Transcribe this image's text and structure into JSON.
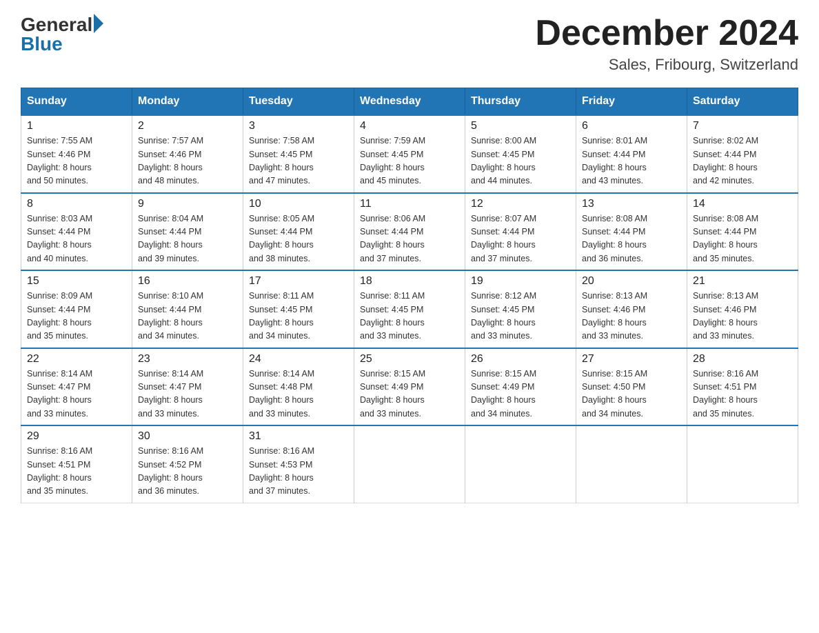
{
  "logo": {
    "general": "General",
    "blue": "Blue"
  },
  "title": "December 2024",
  "subtitle": "Sales, Fribourg, Switzerland",
  "days_of_week": [
    "Sunday",
    "Monday",
    "Tuesday",
    "Wednesday",
    "Thursday",
    "Friday",
    "Saturday"
  ],
  "weeks": [
    [
      {
        "day": 1,
        "info": "Sunrise: 7:55 AM\nSunset: 4:46 PM\nDaylight: 8 hours\nand 50 minutes."
      },
      {
        "day": 2,
        "info": "Sunrise: 7:57 AM\nSunset: 4:46 PM\nDaylight: 8 hours\nand 48 minutes."
      },
      {
        "day": 3,
        "info": "Sunrise: 7:58 AM\nSunset: 4:45 PM\nDaylight: 8 hours\nand 47 minutes."
      },
      {
        "day": 4,
        "info": "Sunrise: 7:59 AM\nSunset: 4:45 PM\nDaylight: 8 hours\nand 45 minutes."
      },
      {
        "day": 5,
        "info": "Sunrise: 8:00 AM\nSunset: 4:45 PM\nDaylight: 8 hours\nand 44 minutes."
      },
      {
        "day": 6,
        "info": "Sunrise: 8:01 AM\nSunset: 4:44 PM\nDaylight: 8 hours\nand 43 minutes."
      },
      {
        "day": 7,
        "info": "Sunrise: 8:02 AM\nSunset: 4:44 PM\nDaylight: 8 hours\nand 42 minutes."
      }
    ],
    [
      {
        "day": 8,
        "info": "Sunrise: 8:03 AM\nSunset: 4:44 PM\nDaylight: 8 hours\nand 40 minutes."
      },
      {
        "day": 9,
        "info": "Sunrise: 8:04 AM\nSunset: 4:44 PM\nDaylight: 8 hours\nand 39 minutes."
      },
      {
        "day": 10,
        "info": "Sunrise: 8:05 AM\nSunset: 4:44 PM\nDaylight: 8 hours\nand 38 minutes."
      },
      {
        "day": 11,
        "info": "Sunrise: 8:06 AM\nSunset: 4:44 PM\nDaylight: 8 hours\nand 37 minutes."
      },
      {
        "day": 12,
        "info": "Sunrise: 8:07 AM\nSunset: 4:44 PM\nDaylight: 8 hours\nand 37 minutes."
      },
      {
        "day": 13,
        "info": "Sunrise: 8:08 AM\nSunset: 4:44 PM\nDaylight: 8 hours\nand 36 minutes."
      },
      {
        "day": 14,
        "info": "Sunrise: 8:08 AM\nSunset: 4:44 PM\nDaylight: 8 hours\nand 35 minutes."
      }
    ],
    [
      {
        "day": 15,
        "info": "Sunrise: 8:09 AM\nSunset: 4:44 PM\nDaylight: 8 hours\nand 35 minutes."
      },
      {
        "day": 16,
        "info": "Sunrise: 8:10 AM\nSunset: 4:44 PM\nDaylight: 8 hours\nand 34 minutes."
      },
      {
        "day": 17,
        "info": "Sunrise: 8:11 AM\nSunset: 4:45 PM\nDaylight: 8 hours\nand 34 minutes."
      },
      {
        "day": 18,
        "info": "Sunrise: 8:11 AM\nSunset: 4:45 PM\nDaylight: 8 hours\nand 33 minutes."
      },
      {
        "day": 19,
        "info": "Sunrise: 8:12 AM\nSunset: 4:45 PM\nDaylight: 8 hours\nand 33 minutes."
      },
      {
        "day": 20,
        "info": "Sunrise: 8:13 AM\nSunset: 4:46 PM\nDaylight: 8 hours\nand 33 minutes."
      },
      {
        "day": 21,
        "info": "Sunrise: 8:13 AM\nSunset: 4:46 PM\nDaylight: 8 hours\nand 33 minutes."
      }
    ],
    [
      {
        "day": 22,
        "info": "Sunrise: 8:14 AM\nSunset: 4:47 PM\nDaylight: 8 hours\nand 33 minutes."
      },
      {
        "day": 23,
        "info": "Sunrise: 8:14 AM\nSunset: 4:47 PM\nDaylight: 8 hours\nand 33 minutes."
      },
      {
        "day": 24,
        "info": "Sunrise: 8:14 AM\nSunset: 4:48 PM\nDaylight: 8 hours\nand 33 minutes."
      },
      {
        "day": 25,
        "info": "Sunrise: 8:15 AM\nSunset: 4:49 PM\nDaylight: 8 hours\nand 33 minutes."
      },
      {
        "day": 26,
        "info": "Sunrise: 8:15 AM\nSunset: 4:49 PM\nDaylight: 8 hours\nand 34 minutes."
      },
      {
        "day": 27,
        "info": "Sunrise: 8:15 AM\nSunset: 4:50 PM\nDaylight: 8 hours\nand 34 minutes."
      },
      {
        "day": 28,
        "info": "Sunrise: 8:16 AM\nSunset: 4:51 PM\nDaylight: 8 hours\nand 35 minutes."
      }
    ],
    [
      {
        "day": 29,
        "info": "Sunrise: 8:16 AM\nSunset: 4:51 PM\nDaylight: 8 hours\nand 35 minutes."
      },
      {
        "day": 30,
        "info": "Sunrise: 8:16 AM\nSunset: 4:52 PM\nDaylight: 8 hours\nand 36 minutes."
      },
      {
        "day": 31,
        "info": "Sunrise: 8:16 AM\nSunset: 4:53 PM\nDaylight: 8 hours\nand 37 minutes."
      },
      null,
      null,
      null,
      null
    ]
  ]
}
